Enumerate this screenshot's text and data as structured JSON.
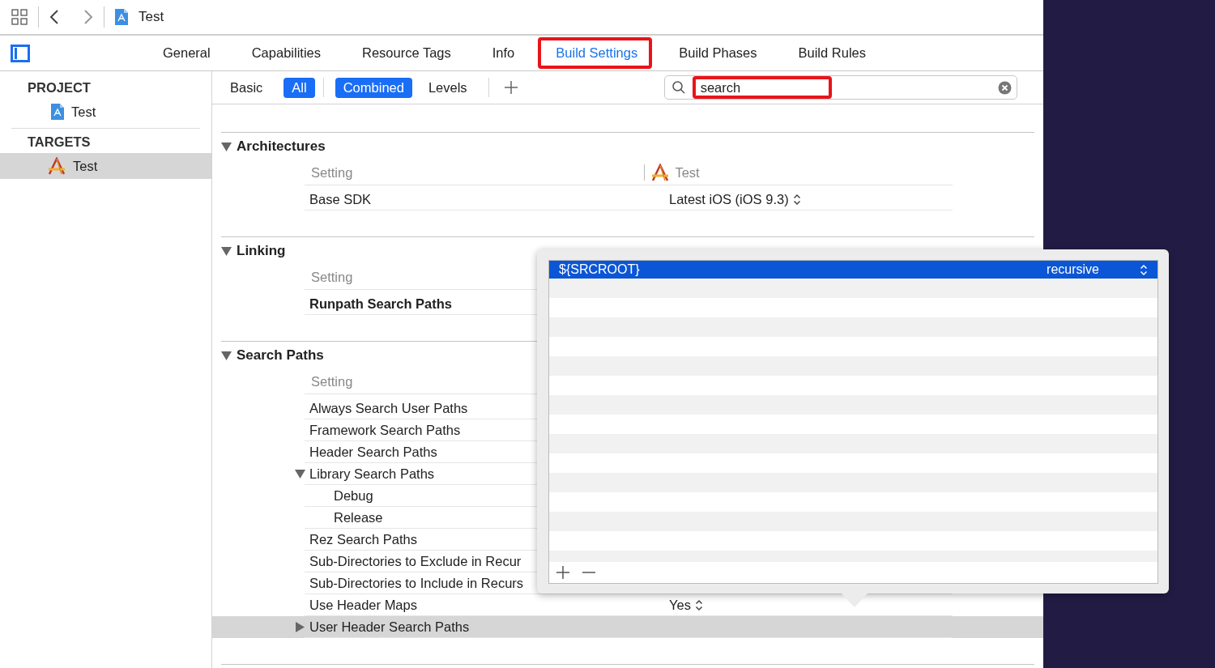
{
  "nav": {
    "title": "Test"
  },
  "tabs": [
    {
      "label": "General",
      "selected": false,
      "highlighted": false
    },
    {
      "label": "Capabilities",
      "selected": false,
      "highlighted": false
    },
    {
      "label": "Resource Tags",
      "selected": false,
      "highlighted": false
    },
    {
      "label": "Info",
      "selected": false,
      "highlighted": false
    },
    {
      "label": "Build Settings",
      "selected": true,
      "highlighted": true
    },
    {
      "label": "Build Phases",
      "selected": false,
      "highlighted": false
    },
    {
      "label": "Build Rules",
      "selected": false,
      "highlighted": false
    }
  ],
  "sidebar": {
    "groups": [
      {
        "heading": "PROJECT",
        "items": [
          {
            "label": "Test",
            "kind": "project",
            "selected": false
          }
        ]
      },
      {
        "heading": "TARGETS",
        "items": [
          {
            "label": "Test",
            "kind": "target",
            "selected": true
          }
        ]
      }
    ]
  },
  "filter_bar": {
    "scope": [
      {
        "label": "Basic",
        "selected": false
      },
      {
        "label": "All",
        "selected": true
      }
    ],
    "view": [
      {
        "label": "Combined",
        "selected": true
      },
      {
        "label": "Levels",
        "selected": false
      }
    ],
    "search": {
      "value": "search",
      "highlighted": true
    }
  },
  "sections": [
    {
      "title": "Architectures",
      "expanded": true,
      "column_header": {
        "setting": "Setting",
        "target": "Test"
      },
      "rows": [
        {
          "kind": "setting",
          "name": "Base SDK",
          "modified": false,
          "selected": false,
          "value": "Latest iOS (iOS 9.3)"
        }
      ]
    },
    {
      "title": "Linking",
      "expanded": true,
      "column_header": {
        "setting": "Setting"
      },
      "rows": [
        {
          "kind": "setting",
          "name": "Runpath Search Paths",
          "modified": true,
          "selected": false
        }
      ]
    },
    {
      "title": "Search Paths",
      "expanded": true,
      "column_header": {
        "setting": "Setting"
      },
      "rows": [
        {
          "kind": "setting",
          "name": "Always Search User Paths",
          "modified": false,
          "selected": false
        },
        {
          "kind": "setting",
          "name": "Framework Search Paths",
          "modified": false,
          "selected": false
        },
        {
          "kind": "setting",
          "name": "Header Search Paths",
          "modified": false,
          "selected": false
        },
        {
          "kind": "group",
          "name": "Library Search Paths",
          "modified": false,
          "selected": false,
          "expanded": true,
          "children": [
            {
              "kind": "setting",
              "name": "Debug",
              "modified": false,
              "selected": false
            },
            {
              "kind": "setting",
              "name": "Release",
              "modified": false,
              "selected": false
            }
          ]
        },
        {
          "kind": "setting",
          "name": "Rez Search Paths",
          "modified": false,
          "selected": false
        },
        {
          "kind": "setting",
          "name": "Sub-Directories to Exclude in Recur",
          "modified": false,
          "selected": false
        },
        {
          "kind": "setting",
          "name": "Sub-Directories to Include in Recurs",
          "modified": false,
          "selected": false
        },
        {
          "kind": "setting",
          "name": "Use Header Maps",
          "modified": false,
          "selected": false,
          "value": "Yes"
        },
        {
          "kind": "group",
          "name": "User Header Search Paths",
          "modified": false,
          "selected": true,
          "expanded": false
        }
      ]
    }
  ],
  "popover": {
    "rows": [
      {
        "path": "${SRCROOT}",
        "option": "recursive",
        "selected": true
      }
    ]
  }
}
